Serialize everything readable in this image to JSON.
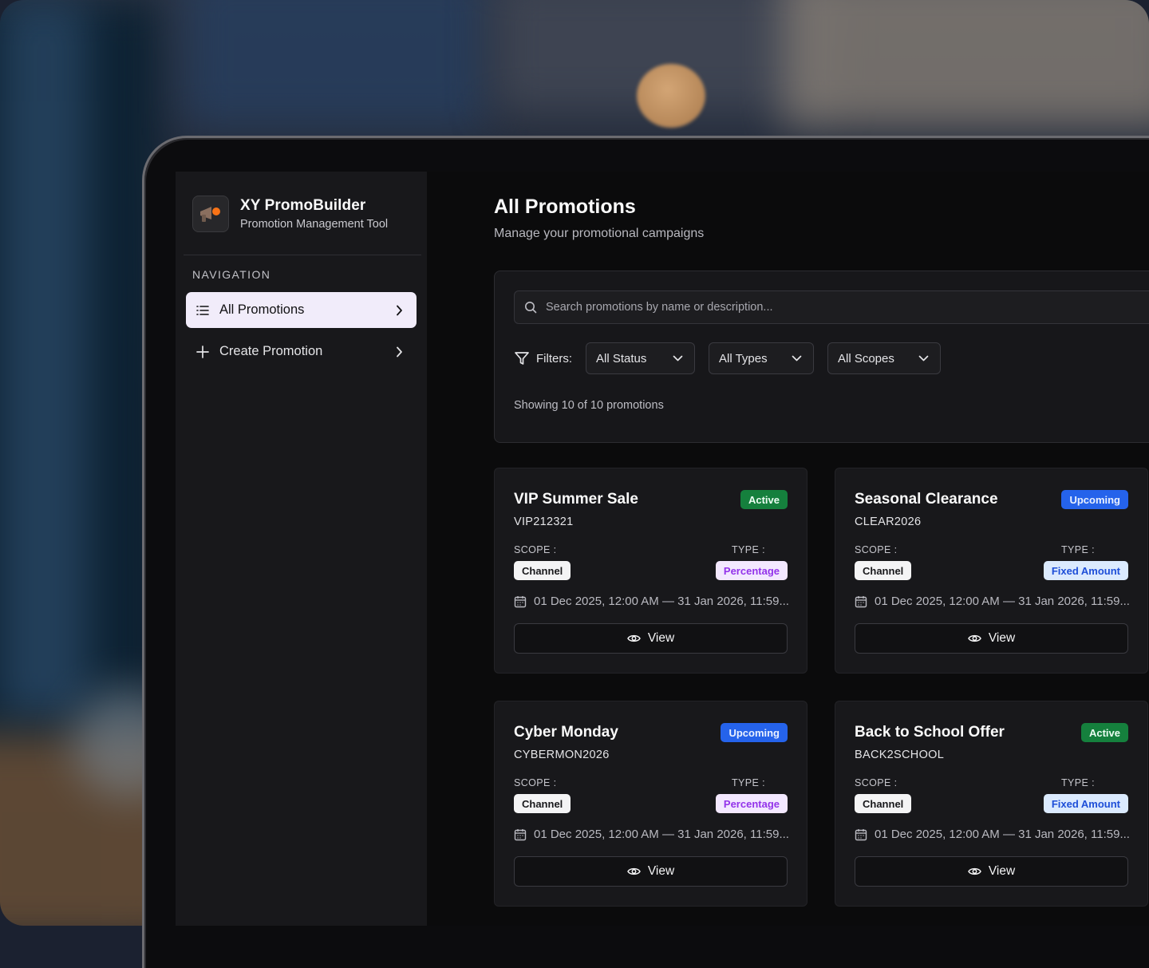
{
  "app": {
    "title": "XY PromoBuilder",
    "subtitle": "Promotion Management Tool"
  },
  "sidebar": {
    "heading": "NAVIGATION",
    "items": [
      {
        "label": "All Promotions",
        "icon": "list-icon",
        "active": true
      },
      {
        "label": "Create Promotion",
        "icon": "plus-icon",
        "active": false
      }
    ]
  },
  "page": {
    "title": "All Promotions",
    "subtitle": "Manage your promotional campaigns"
  },
  "search": {
    "placeholder": "Search promotions by name or description...",
    "value": ""
  },
  "filters": {
    "label": "Filters:",
    "status": "All Status",
    "type": "All Types",
    "scope": "All Scopes"
  },
  "summary": {
    "showing": "Showing 10 of 10 promotions"
  },
  "labels": {
    "scope": "SCOPE :",
    "type": "TYPE :",
    "view": "View"
  },
  "promotions": [
    {
      "name": "VIP Summer Sale",
      "code": "VIP212321",
      "status": "Active",
      "scope": "Channel",
      "type": "Percentage",
      "dates": "01 Dec 2025, 12:00 AM — 31 Jan 2026, 11:59..."
    },
    {
      "name": "Seasonal Clearance",
      "code": "CLEAR2026",
      "status": "Upcoming",
      "scope": "Channel",
      "type": "Fixed Amount",
      "dates": "01 Dec 2025, 12:00 AM — 31 Jan 2026, 11:59..."
    },
    {
      "name": "Cyber Monday",
      "code": "CYBERMON2026",
      "status": "Upcoming",
      "scope": "Channel",
      "type": "Percentage",
      "dates": "01 Dec 2025, 12:00 AM — 31 Jan 2026, 11:59..."
    },
    {
      "name": "Back to School Offer",
      "code": "BACK2SCHOOL",
      "status": "Active",
      "scope": "Channel",
      "type": "Fixed Amount",
      "dates": "01 Dec 2025, 12:00 AM — 31 Jan 2026, 11:59..."
    }
  ],
  "colors": {
    "active_badge": "#15803d",
    "upcoming_badge": "#2563eb",
    "percentage_chip_text": "#9333ea",
    "fixed_chip_text": "#1d4ed8",
    "logo_accent": "#f97316"
  }
}
